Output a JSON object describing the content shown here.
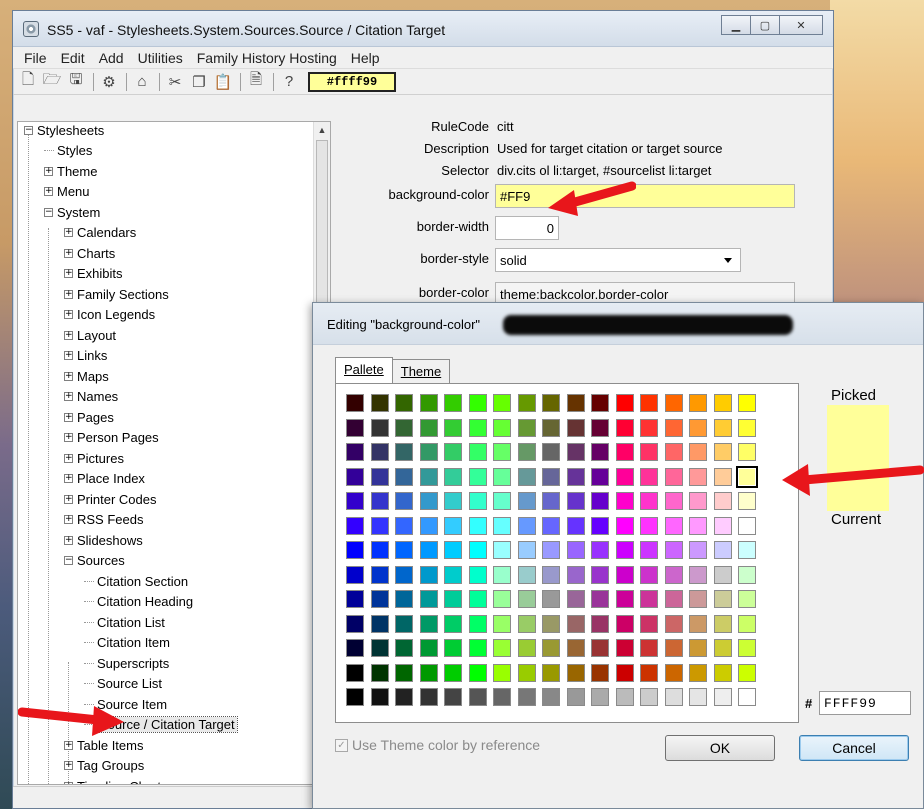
{
  "window": {
    "title": "SS5 - vaf - Stylesheets.System.Sources.Source / Citation Target"
  },
  "menu": [
    "File",
    "Edit",
    "Add",
    "Utilities",
    "Family History Hosting",
    "Help"
  ],
  "toolbar": {
    "color_value": "#ffff99"
  },
  "icons": [
    "new-icon",
    "open-icon",
    "save-icon",
    "settings-icon",
    "home-icon",
    "cut-icon",
    "copy-icon",
    "paste-icon",
    "page-icon",
    "help-icon"
  ],
  "tree": {
    "items": [
      {
        "label": "Stylesheets",
        "level": 0,
        "type": "minus"
      },
      {
        "label": "Styles",
        "level": 1,
        "type": "leaf"
      },
      {
        "label": "Theme",
        "level": 1,
        "type": "plus"
      },
      {
        "label": "Menu",
        "level": 1,
        "type": "plus"
      },
      {
        "label": "System",
        "level": 1,
        "type": "minus"
      },
      {
        "label": "Calendars",
        "level": 2,
        "type": "plus"
      },
      {
        "label": "Charts",
        "level": 2,
        "type": "plus"
      },
      {
        "label": "Exhibits",
        "level": 2,
        "type": "plus"
      },
      {
        "label": "Family Sections",
        "level": 2,
        "type": "plus"
      },
      {
        "label": "Icon Legends",
        "level": 2,
        "type": "plus"
      },
      {
        "label": "Layout",
        "level": 2,
        "type": "plus"
      },
      {
        "label": "Links",
        "level": 2,
        "type": "plus"
      },
      {
        "label": "Maps",
        "level": 2,
        "type": "plus"
      },
      {
        "label": "Names",
        "level": 2,
        "type": "plus"
      },
      {
        "label": "Pages",
        "level": 2,
        "type": "plus"
      },
      {
        "label": "Person Pages",
        "level": 2,
        "type": "plus"
      },
      {
        "label": "Pictures",
        "level": 2,
        "type": "plus"
      },
      {
        "label": "Place Index",
        "level": 2,
        "type": "plus"
      },
      {
        "label": "Printer Codes",
        "level": 2,
        "type": "plus"
      },
      {
        "label": "RSS Feeds",
        "level": 2,
        "type": "plus"
      },
      {
        "label": "Slideshows",
        "level": 2,
        "type": "plus"
      },
      {
        "label": "Sources",
        "level": 2,
        "type": "minus"
      },
      {
        "label": "Citation Section",
        "level": 3,
        "type": "leaf"
      },
      {
        "label": "Citation Heading",
        "level": 3,
        "type": "leaf"
      },
      {
        "label": "Citation List",
        "level": 3,
        "type": "leaf"
      },
      {
        "label": "Citation Item",
        "level": 3,
        "type": "leaf"
      },
      {
        "label": "Superscripts",
        "level": 3,
        "type": "leaf"
      },
      {
        "label": "Source List",
        "level": 3,
        "type": "leaf"
      },
      {
        "label": "Source Item",
        "level": 3,
        "type": "leaf"
      },
      {
        "label": "Source / Citation Target",
        "level": 3,
        "type": "leaf",
        "selected": true
      },
      {
        "label": "Table Items",
        "level": 2,
        "type": "plus"
      },
      {
        "label": "Tag Groups",
        "level": 2,
        "type": "plus"
      },
      {
        "label": "Timeline Charts",
        "level": 2,
        "type": "plus"
      }
    ]
  },
  "props": {
    "rulecode_label": "RuleCode",
    "rulecode_value": "citt",
    "description_label": "Description",
    "description_value": "Used for target citation or target source",
    "selector_label": "Selector",
    "selector_value": "div.cits ol li:target, #sourcelist li:target",
    "bgcolor_label": "background-color",
    "bgcolor_value": "#FF9",
    "border_width_label": "border-width",
    "border_width_value": "0",
    "border_style_label": "border-style",
    "border_style_value": "solid",
    "border_color_label": "border-color",
    "border_color_value": "theme:backcolor.border-color"
  },
  "dialog": {
    "title": "Editing \"background-color\"",
    "tab_pallete": "Pallete",
    "tab_theme": "Theme",
    "picked_label": "Picked",
    "current_label": "Current",
    "picked_color": "#ffff99",
    "hash": "#",
    "hex_value": "FFFF99",
    "use_theme_label": "Use Theme color by reference",
    "use_theme_checked": true,
    "ok_label": "OK",
    "cancel_label": "Cancel",
    "palette": [
      [
        "#330000",
        "#333300",
        "#336600",
        "#339900",
        "#33cc00",
        "#33ff00",
        "#66ff00",
        "#669900",
        "#666600",
        "#663300",
        "#660000",
        "#ff0000",
        "#ff3300",
        "#ff6600",
        "#ff9900",
        "#ffcc00",
        "#ffff00"
      ],
      [
        "#330033",
        "#333333",
        "#336633",
        "#339933",
        "#33cc33",
        "#33ff33",
        "#66ff33",
        "#669933",
        "#666633",
        "#663333",
        "#660033",
        "#ff0033",
        "#ff3333",
        "#ff6633",
        "#ff9933",
        "#ffcc33",
        "#ffff33"
      ],
      [
        "#330066",
        "#333366",
        "#336666",
        "#339966",
        "#33cc66",
        "#33ff66",
        "#66ff66",
        "#669966",
        "#666666",
        "#663366",
        "#660066",
        "#ff0066",
        "#ff3366",
        "#ff6666",
        "#ff9966",
        "#ffcc66",
        "#ffff66"
      ],
      [
        "#330099",
        "#333399",
        "#336699",
        "#339999",
        "#33cc99",
        "#33ff99",
        "#66ff99",
        "#669999",
        "#666699",
        "#663399",
        "#660099",
        "#ff0099",
        "#ff3399",
        "#ff6699",
        "#ff9999",
        "#ffcc99",
        "#ffff99"
      ],
      [
        "#3300cc",
        "#3333cc",
        "#3366cc",
        "#3399cc",
        "#33cccc",
        "#33ffcc",
        "#66ffcc",
        "#6699cc",
        "#6666cc",
        "#6633cc",
        "#6600cc",
        "#ff00cc",
        "#ff33cc",
        "#ff66cc",
        "#ff99cc",
        "#ffcccc",
        "#ffffcc"
      ],
      [
        "#3300ff",
        "#3333ff",
        "#3366ff",
        "#3399ff",
        "#33ccff",
        "#33ffff",
        "#66ffff",
        "#6699ff",
        "#6666ff",
        "#6633ff",
        "#6600ff",
        "#ff00ff",
        "#ff33ff",
        "#ff66ff",
        "#ff99ff",
        "#ffccff",
        "#ffffff"
      ],
      [
        "#0000ff",
        "#0033ff",
        "#0066ff",
        "#0099ff",
        "#00ccff",
        "#00ffff",
        "#99ffff",
        "#99ccff",
        "#9999ff",
        "#9966ff",
        "#9933ff",
        "#cc00ff",
        "#cc33ff",
        "#cc66ff",
        "#cc99ff",
        "#ccccff",
        "#ccffff"
      ],
      [
        "#0000cc",
        "#0033cc",
        "#0066cc",
        "#0099cc",
        "#00cccc",
        "#00ffcc",
        "#99ffcc",
        "#99cccc",
        "#9999cc",
        "#9966cc",
        "#9933cc",
        "#cc00cc",
        "#cc33cc",
        "#cc66cc",
        "#cc99cc",
        "#cccccc",
        "#ccffcc"
      ],
      [
        "#000099",
        "#003399",
        "#006699",
        "#009999",
        "#00cc99",
        "#00ff99",
        "#99ff99",
        "#99cc99",
        "#999999",
        "#996699",
        "#993399",
        "#cc0099",
        "#cc3399",
        "#cc6699",
        "#cc9999",
        "#cccc99",
        "#ccff99"
      ],
      [
        "#000066",
        "#003366",
        "#006666",
        "#009966",
        "#00cc66",
        "#00ff66",
        "#99ff66",
        "#99cc66",
        "#999966",
        "#996666",
        "#993366",
        "#cc0066",
        "#cc3366",
        "#cc6666",
        "#cc9966",
        "#cccc66",
        "#ccff66"
      ],
      [
        "#000033",
        "#003333",
        "#006633",
        "#009933",
        "#00cc33",
        "#00ff33",
        "#99ff33",
        "#99cc33",
        "#999933",
        "#996633",
        "#993333",
        "#cc0033",
        "#cc3333",
        "#cc6633",
        "#cc9933",
        "#cccc33",
        "#ccff33"
      ],
      [
        "#000000",
        "#003300",
        "#006600",
        "#009900",
        "#00cc00",
        "#00ff00",
        "#99ff00",
        "#99cc00",
        "#999900",
        "#996600",
        "#993300",
        "#cc0000",
        "#cc3300",
        "#cc6600",
        "#cc9900",
        "#cccc00",
        "#ccff00"
      ],
      [
        "#000000",
        "#111111",
        "#222222",
        "#333333",
        "#444444",
        "#555555",
        "#666666",
        "#777777",
        "#888888",
        "#999999",
        "#aaaaaa",
        "#bbbbbb",
        "#cccccc",
        "#dddddd",
        "#e5e5e5",
        "#eeeeee",
        "#ffffff"
      ]
    ],
    "picked_cell": [
      3,
      16
    ]
  },
  "annotation_color": "#e8161b"
}
